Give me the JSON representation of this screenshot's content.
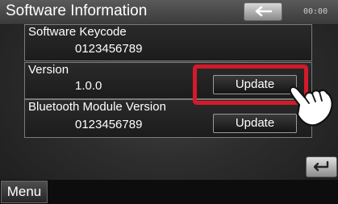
{
  "header": {
    "title": "Software Information",
    "clock": "00:00"
  },
  "rows": [
    {
      "label": "Software Keycode",
      "value": "0123456789"
    },
    {
      "label": "Version",
      "value": "1.0.0",
      "button": "Update"
    },
    {
      "label": "Bluetooth Module Version",
      "value": "0123456789",
      "button": "Update"
    }
  ],
  "footer": {
    "menu_label": "Menu"
  },
  "icons": {
    "back": "back-arrow-icon",
    "return": "return-icon",
    "pointer": "pointing-hand-icon"
  },
  "colors": {
    "highlight": "#d41a2a"
  }
}
